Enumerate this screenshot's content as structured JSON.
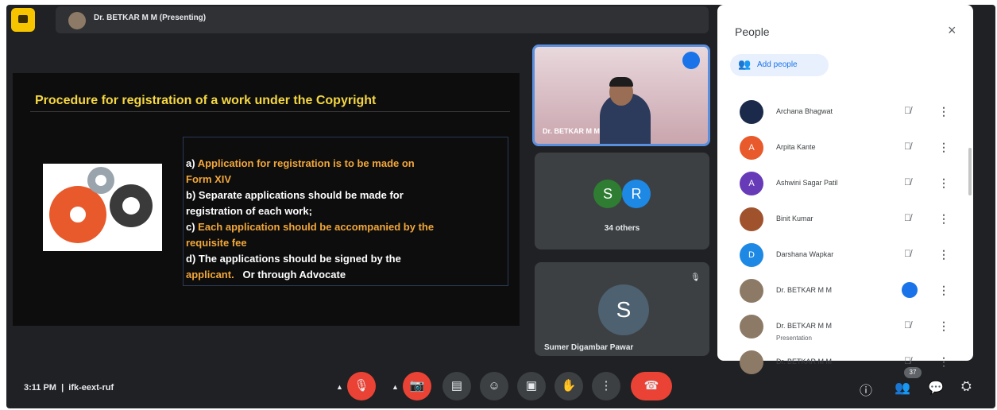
{
  "header": {
    "presenter_label": "Dr. BETKAR M M (Presenting)"
  },
  "slide": {
    "title": "Procedure for registration of a work under the Copyright",
    "lines": [
      {
        "prefix": "a) ",
        "text": "Application for registration is to be made on",
        "color": "yellow"
      },
      {
        "prefix": "",
        "text": "Form XIV",
        "color": "yellow"
      },
      {
        "prefix": "",
        "text": "b) Separate applications should be made for",
        "color": "white"
      },
      {
        "prefix": "",
        "text": "registration of each work;",
        "color": "white"
      },
      {
        "prefix": "c) ",
        "text": "Each application should be accompanied by the",
        "color": "yellow"
      },
      {
        "prefix": "",
        "text": "requisite fee",
        "color": "yellow"
      },
      {
        "prefix": "",
        "text": "d) The applications should be signed by the",
        "color": "white"
      },
      {
        "prefix": "",
        "text": "applicant.",
        "suffix": "   Or through Advocate",
        "color": "yellow"
      }
    ]
  },
  "tiles": {
    "presenter_label": "Dr. BETKAR M M",
    "others": {
      "initials": [
        "S",
        "R"
      ],
      "label": "34 others"
    },
    "sumer": {
      "initial": "S",
      "name": "Sumer Digambar Pawar"
    }
  },
  "people_panel": {
    "title": "People",
    "close_icon": "×",
    "add_label": "Add people",
    "participants": [
      {
        "name": "Archana Bhagwat",
        "initial": "",
        "avatar_color": "#1b2a4a",
        "status": "muted"
      },
      {
        "name": "Arpita Kante",
        "initial": "A",
        "avatar_color": "#e8592b",
        "status": "muted"
      },
      {
        "name": "Ashwini Sagar Patil",
        "initial": "A",
        "avatar_color": "#673ab7",
        "status": "muted"
      },
      {
        "name": "Binit Kumar",
        "initial": "",
        "avatar_color": "#a0522d",
        "status": "muted"
      },
      {
        "name": "Darshana Wapkar",
        "initial": "D",
        "avatar_color": "#1e88e5",
        "status": "muted"
      },
      {
        "name": "Dr. BETKAR M M",
        "initial": "",
        "avatar_color": "#8c7a66",
        "status": "speaking",
        "tag": ""
      },
      {
        "name": "Dr. BETKAR M M",
        "initial": "",
        "avatar_color": "#8c7a66",
        "status": "muted",
        "tag": "Presentation"
      },
      {
        "name": "Dr. BETKAR M M",
        "initial": "",
        "avatar_color": "#8c7a66",
        "status": "muted"
      }
    ]
  },
  "bottom_bar": {
    "time": "3:11 PM",
    "meeting_code": "ifk-eext-ruf",
    "participant_count": "37",
    "colors": {
      "end_call": "#ea4335",
      "accent": "#1a73e8"
    }
  }
}
